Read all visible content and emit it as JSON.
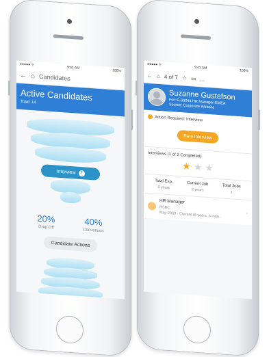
{
  "left_screen": {
    "status": {
      "carrier": "●●●●● ᯤ",
      "time": "9:41 AM",
      "battery": "100%"
    },
    "nav": {
      "back_icon": "back-arrow-icon",
      "home_icon": "home-icon",
      "title": "Candidates"
    },
    "header": {
      "title": "Active Candidates",
      "total": "Total: 14"
    },
    "funnel": {
      "stage_label": "Interview",
      "stage_count": "2"
    },
    "stats": [
      {
        "value": "20%",
        "label": "Drop Off"
      },
      {
        "value": "40%",
        "label": "Conversion"
      }
    ],
    "actions_button": "Candidate Actions"
  },
  "right_screen": {
    "status": {
      "carrier": "●●●●● ᯤ",
      "time": "9:41 AM",
      "battery": "100%"
    },
    "nav": {
      "pager": "4 of 7",
      "more": "..."
    },
    "candidate": {
      "name": "Suzanne Gustafson",
      "requisition": "For: R-00044 HR Manager-EMEA",
      "source": "Source: Corporate Website"
    },
    "action_required": "Action Required: Interview",
    "rate_button": "Rate Interview",
    "interviews": {
      "label": "Interviews (1 of 2 Completed)",
      "rating": 1,
      "max": 3
    },
    "experience": [
      {
        "title": "Total Exp.",
        "value": "8 years"
      },
      {
        "title": "Current Job",
        "value": "8 years"
      },
      {
        "title": "Total Jobs",
        "value": "1"
      }
    ],
    "job": {
      "title": "HR Manager",
      "company": "HSBC",
      "dates": "May 2009 - Current (8 years, 4 mon..."
    }
  }
}
